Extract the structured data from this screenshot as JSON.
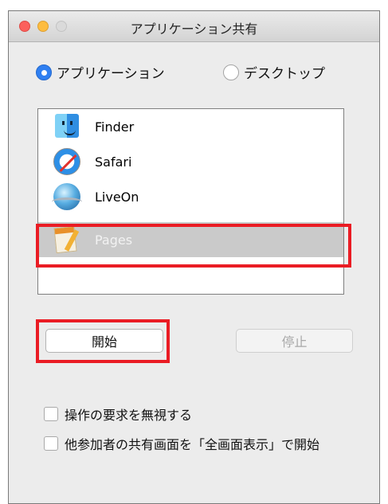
{
  "window": {
    "title": "アプリケーション共有"
  },
  "share_mode": {
    "options": [
      {
        "label": "アプリケーション",
        "selected": true
      },
      {
        "label": "デスクトップ",
        "selected": false
      }
    ]
  },
  "app_list": {
    "items": [
      {
        "name": "Finder",
        "icon": "finder-icon",
        "selected": false
      },
      {
        "name": "Safari",
        "icon": "safari-icon",
        "selected": false
      },
      {
        "name": "LiveOn",
        "icon": "liveon-icon",
        "selected": false
      },
      {
        "name": "Pages",
        "icon": "pages-icon",
        "selected": true
      }
    ]
  },
  "buttons": {
    "start": "開始",
    "stop": "停止"
  },
  "options": {
    "ignore_requests": {
      "label": "操作の要求を無視する",
      "checked": false
    },
    "fullscreen_start": {
      "label": "他参加者の共有画面を「全画面表示」で開始",
      "checked": false
    }
  },
  "colors": {
    "highlight": "#ea1c24",
    "accent": "#2f7ff1"
  }
}
